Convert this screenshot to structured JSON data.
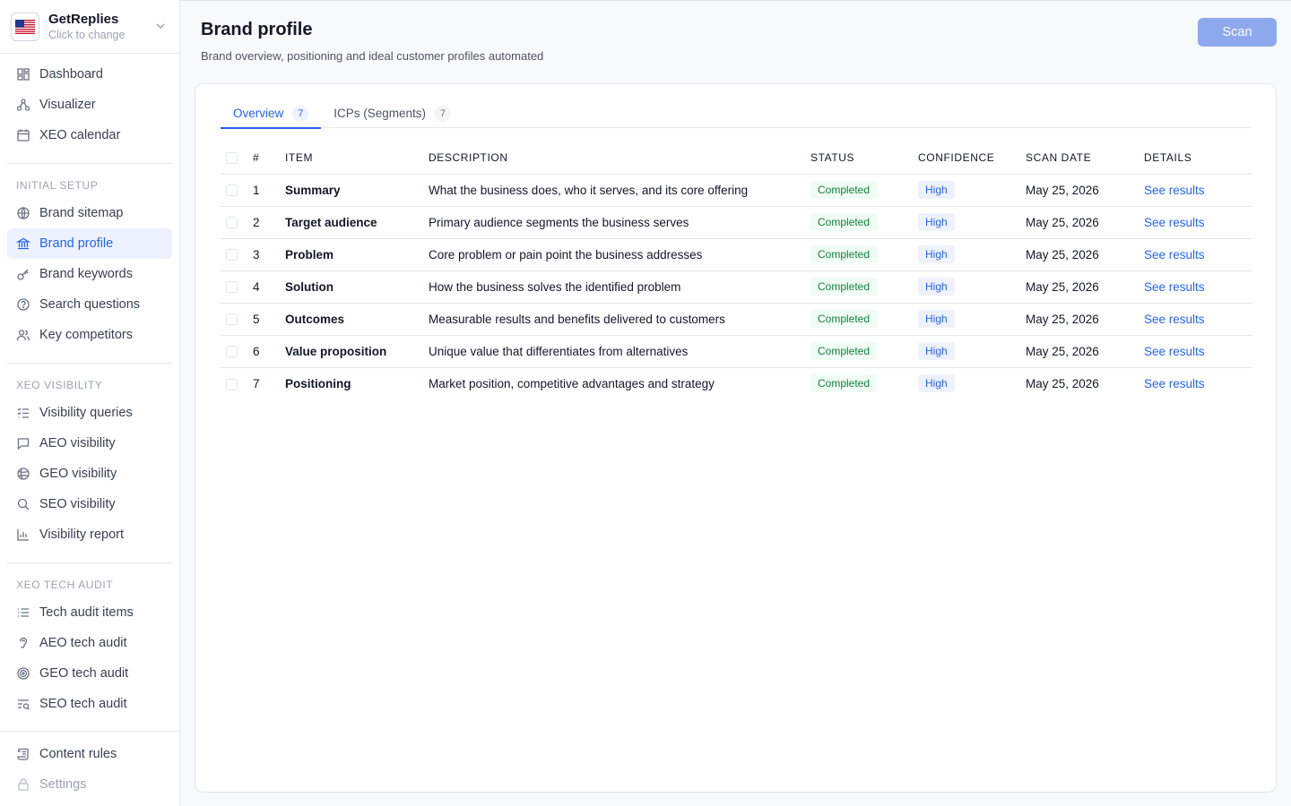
{
  "brand": {
    "name": "GetReplies",
    "subtitle": "Click to change"
  },
  "nav_top": [
    {
      "label": "Dashboard",
      "icon": "dashboard-icon"
    },
    {
      "label": "Visualizer",
      "icon": "visualizer-icon"
    },
    {
      "label": "XEO calendar",
      "icon": "calendar-icon"
    }
  ],
  "sections": {
    "initial_setup": "INITIAL SETUP",
    "xeo_visibility": "XEO VISIBILITY",
    "xeo_tech_audit": "XEO TECH AUDIT"
  },
  "nav_initial": [
    {
      "label": "Brand sitemap",
      "icon": "globe-icon"
    },
    {
      "label": "Brand profile",
      "icon": "bank-icon",
      "active": true
    },
    {
      "label": "Brand keywords",
      "icon": "key-icon"
    },
    {
      "label": "Search questions",
      "icon": "question-icon"
    },
    {
      "label": "Key competitors",
      "icon": "users-icon"
    }
  ],
  "nav_visibility": [
    {
      "label": "Visibility queries",
      "icon": "list-check-icon"
    },
    {
      "label": "AEO visibility",
      "icon": "chat-icon"
    },
    {
      "label": "GEO visibility",
      "icon": "globe-grid-icon"
    },
    {
      "label": "SEO visibility",
      "icon": "search-icon"
    },
    {
      "label": "Visibility report",
      "icon": "bar-chart-icon"
    }
  ],
  "nav_audit": [
    {
      "label": "Tech audit items",
      "icon": "list-icon"
    },
    {
      "label": "AEO tech audit",
      "icon": "ear-icon"
    },
    {
      "label": "GEO tech audit",
      "icon": "target-icon"
    },
    {
      "label": "SEO tech audit",
      "icon": "list-search-icon"
    }
  ],
  "nav_bottom": [
    {
      "label": "Content rules",
      "icon": "scroll-icon"
    },
    {
      "label": "Settings",
      "icon": "lock-icon",
      "disabled": true
    }
  ],
  "page": {
    "title": "Brand profile",
    "subtitle": "Brand overview, positioning and ideal customer profiles automated",
    "scan_label": "Scan"
  },
  "tabs": [
    {
      "label": "Overview",
      "count": "7",
      "active": true
    },
    {
      "label": "ICPs (Segments)",
      "count": "7",
      "active": false
    }
  ],
  "table": {
    "headers": {
      "num": "#",
      "item": "ITEM",
      "description": "DESCRIPTION",
      "status": "STATUS",
      "confidence": "CONFIDENCE",
      "scan_date": "SCAN DATE",
      "details": "DETAILS"
    },
    "rows": [
      {
        "num": "1",
        "item": "Summary",
        "description": "What the business does, who it serves, and its core offering",
        "status": "Completed",
        "confidence": "High",
        "date": "May 25, 2026",
        "details": "See results"
      },
      {
        "num": "2",
        "item": "Target audience",
        "description": "Primary audience segments the business serves",
        "status": "Completed",
        "confidence": "High",
        "date": "May 25, 2026",
        "details": "See results"
      },
      {
        "num": "3",
        "item": "Problem",
        "description": "Core problem or pain point the business addresses",
        "status": "Completed",
        "confidence": "High",
        "date": "May 25, 2026",
        "details": "See results"
      },
      {
        "num": "4",
        "item": "Solution",
        "description": "How the business solves the identified problem",
        "status": "Completed",
        "confidence": "High",
        "date": "May 25, 2026",
        "details": "See results"
      },
      {
        "num": "5",
        "item": "Outcomes",
        "description": "Measurable results and benefits delivered to customers",
        "status": "Completed",
        "confidence": "High",
        "date": "May 25, 2026",
        "details": "See results"
      },
      {
        "num": "6",
        "item": "Value proposition",
        "description": "Unique value that differentiates from alternatives",
        "status": "Completed",
        "confidence": "High",
        "date": "May 25, 2026",
        "details": "See results"
      },
      {
        "num": "7",
        "item": "Positioning",
        "description": "Market position, competitive advantages and strategy",
        "status": "Completed",
        "confidence": "High",
        "date": "May 25, 2026",
        "details": "See results"
      }
    ]
  },
  "colors": {
    "accent": "#2563eb",
    "scan_button": "#8ea8ee",
    "status_green": "#15803d",
    "active_nav_bg": "#eef2ff"
  }
}
